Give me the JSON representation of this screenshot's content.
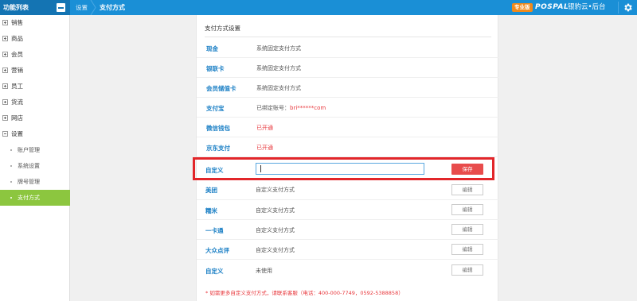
{
  "topbar": {
    "menu_title": "功能列表",
    "breadcrumb_home": "设置",
    "breadcrumb_current": "支付方式",
    "pro_badge": "专业版",
    "logo_text": "POSPAL",
    "logo_cn": "银豹云•后台"
  },
  "sidebar": {
    "items": [
      {
        "label": "销售"
      },
      {
        "label": "商品"
      },
      {
        "label": "会员"
      },
      {
        "label": "营销"
      },
      {
        "label": "员工"
      },
      {
        "label": "货流"
      },
      {
        "label": "网店"
      },
      {
        "label": "设置"
      }
    ],
    "sub_items": [
      {
        "label": "账户管理"
      },
      {
        "label": "系统设置"
      },
      {
        "label": "牌号管理"
      },
      {
        "label": "支付方式"
      }
    ],
    "active_sub": "支付方式"
  },
  "panel": {
    "title": "支付方式设置",
    "rows": [
      {
        "name": "现金",
        "desc": "系统固定支付方式"
      },
      {
        "name": "银联卡",
        "desc": "系统固定支付方式"
      },
      {
        "name": "会员储值卡",
        "desc": "系统固定支付方式"
      },
      {
        "name": "支付宝",
        "desc_prefix": "已绑定账号：",
        "desc_account": "bri******com"
      },
      {
        "name": "微信钱包",
        "desc": "已开通"
      },
      {
        "name": "京东支付",
        "desc": "已开通"
      }
    ],
    "custom_input": {
      "label": "自定义",
      "value": "",
      "save_label": "保存"
    },
    "custom_rows": [
      {
        "name": "美团",
        "desc": "自定义支付方式",
        "button": "编辑"
      },
      {
        "name": "糯米",
        "desc": "自定义支付方式",
        "button": "编辑"
      },
      {
        "name": "一卡通",
        "desc": "自定义支付方式",
        "button": "编辑"
      },
      {
        "name": "大众点评",
        "desc": "自定义支付方式",
        "button": "编辑"
      },
      {
        "name": "自定义",
        "desc": "未使用",
        "button": "编辑"
      }
    ],
    "footnote": "* 如需更多自定义支付方式，请联系客服（电话：400-000-7749，0592-5388858）"
  },
  "colors": {
    "topbar": "#1a8fd6",
    "active_menu": "#8cc63f",
    "save_button": "#e84c4c",
    "highlight_border": "#e2262a",
    "link_blue": "#1a7fc5"
  }
}
